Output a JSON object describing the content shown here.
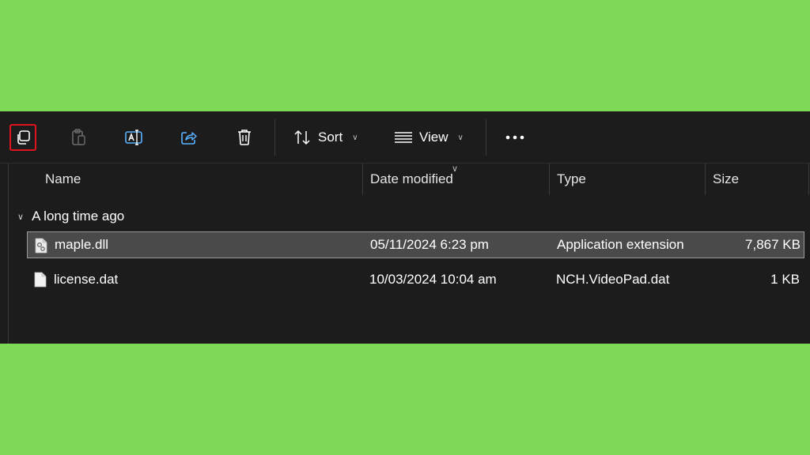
{
  "toolbar": {
    "sort_label": "Sort",
    "view_label": "View",
    "buttons": [
      "copy-icon",
      "paste-icon",
      "rename-icon",
      "share-icon",
      "delete-icon",
      "more-icon"
    ]
  },
  "columns": {
    "name": "Name",
    "date": "Date modified",
    "type": "Type",
    "size": "Size"
  },
  "group": {
    "label": "A long time ago"
  },
  "files": [
    {
      "name": "maple.dll",
      "date": "05/11/2024 6:23 pm",
      "type": "Application extension",
      "size": "7,867 KB",
      "icon": "dll-file-icon"
    },
    {
      "name": "license.dat",
      "date": "10/03/2024 10:04 am",
      "type": "NCH.VideoPad.dat",
      "size": "1 KB",
      "icon": "file-icon"
    }
  ],
  "colors": {
    "background": "#7ed957",
    "window": "#1c1c1c",
    "selection": "#4a4a4a",
    "highlight_border": "#e0141e"
  }
}
